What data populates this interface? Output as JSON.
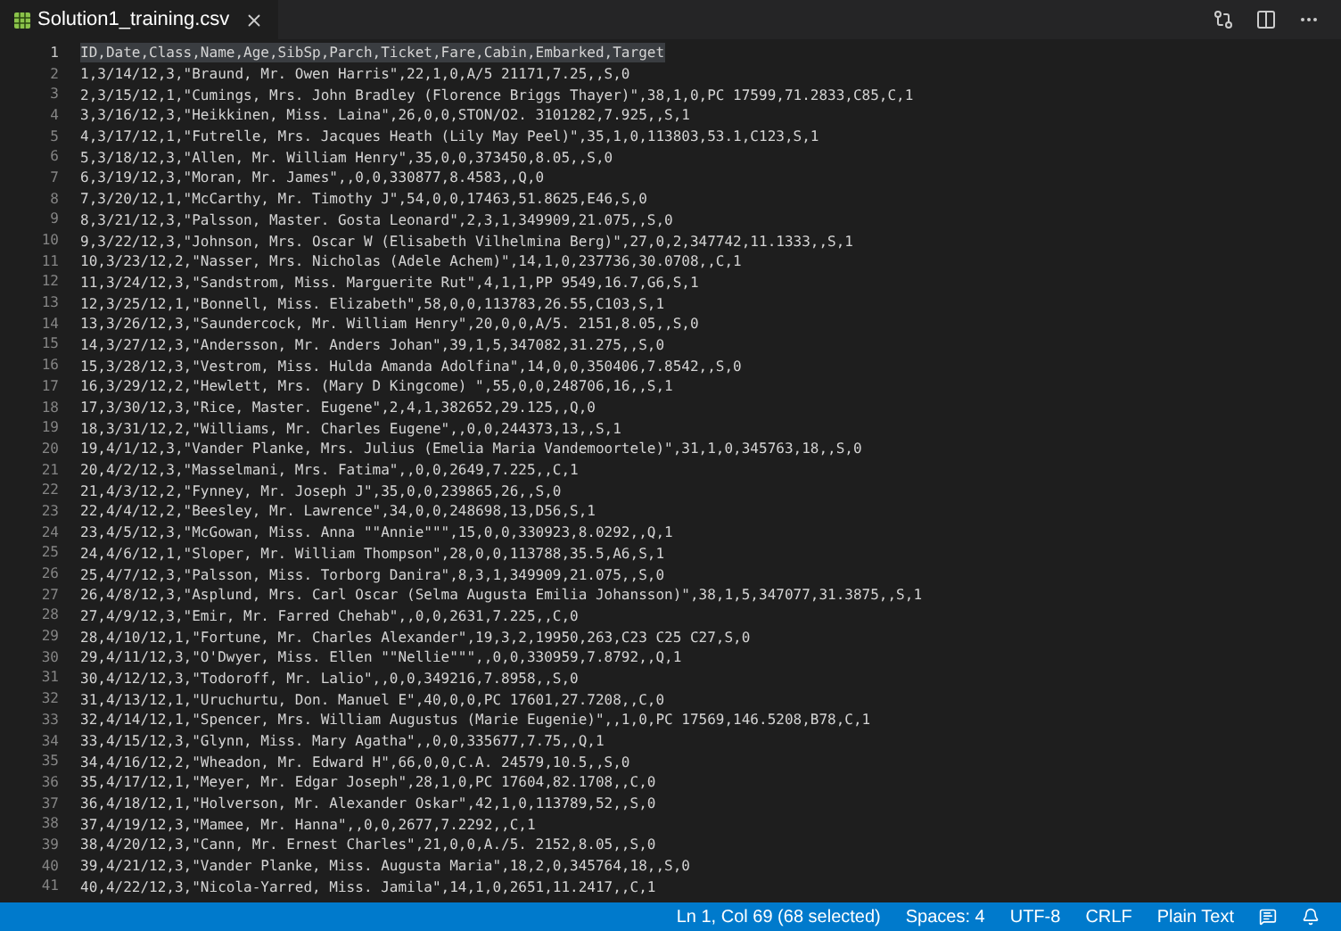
{
  "tab": {
    "title": "Solution1_training.csv",
    "selected": true
  },
  "editor": {
    "lines": [
      {
        "number": "1",
        "text": "ID,Date,Class,Name,Age,SibSp,Parch,Ticket,Fare,Cabin,Embarked,Target",
        "selected": true
      },
      {
        "number": "2",
        "text": "1,3/14/12,3,\"Braund, Mr. Owen Harris\",22,1,0,A/5 21171,7.25,,S,0",
        "selected": false
      },
      {
        "number": "3",
        "text": "2,3/15/12,1,\"Cumings, Mrs. John Bradley (Florence Briggs Thayer)\",38,1,0,PC 17599,71.2833,C85,C,1",
        "selected": false
      },
      {
        "number": "4",
        "text": "3,3/16/12,3,\"Heikkinen, Miss. Laina\",26,0,0,STON/O2. 3101282,7.925,,S,1",
        "selected": false
      },
      {
        "number": "5",
        "text": "4,3/17/12,1,\"Futrelle, Mrs. Jacques Heath (Lily May Peel)\",35,1,0,113803,53.1,C123,S,1",
        "selected": false
      },
      {
        "number": "6",
        "text": "5,3/18/12,3,\"Allen, Mr. William Henry\",35,0,0,373450,8.05,,S,0",
        "selected": false
      },
      {
        "number": "7",
        "text": "6,3/19/12,3,\"Moran, Mr. James\",,0,0,330877,8.4583,,Q,0",
        "selected": false
      },
      {
        "number": "8",
        "text": "7,3/20/12,1,\"McCarthy, Mr. Timothy J\",54,0,0,17463,51.8625,E46,S,0",
        "selected": false
      },
      {
        "number": "9",
        "text": "8,3/21/12,3,\"Palsson, Master. Gosta Leonard\",2,3,1,349909,21.075,,S,0",
        "selected": false
      },
      {
        "number": "10",
        "text": "9,3/22/12,3,\"Johnson, Mrs. Oscar W (Elisabeth Vilhelmina Berg)\",27,0,2,347742,11.1333,,S,1",
        "selected": false
      },
      {
        "number": "11",
        "text": "10,3/23/12,2,\"Nasser, Mrs. Nicholas (Adele Achem)\",14,1,0,237736,30.0708,,C,1",
        "selected": false
      },
      {
        "number": "12",
        "text": "11,3/24/12,3,\"Sandstrom, Miss. Marguerite Rut\",4,1,1,PP 9549,16.7,G6,S,1",
        "selected": false
      },
      {
        "number": "13",
        "text": "12,3/25/12,1,\"Bonnell, Miss. Elizabeth\",58,0,0,113783,26.55,C103,S,1",
        "selected": false
      },
      {
        "number": "14",
        "text": "13,3/26/12,3,\"Saundercock, Mr. William Henry\",20,0,0,A/5. 2151,8.05,,S,0",
        "selected": false
      },
      {
        "number": "15",
        "text": "14,3/27/12,3,\"Andersson, Mr. Anders Johan\",39,1,5,347082,31.275,,S,0",
        "selected": false
      },
      {
        "number": "16",
        "text": "15,3/28/12,3,\"Vestrom, Miss. Hulda Amanda Adolfina\",14,0,0,350406,7.8542,,S,0",
        "selected": false
      },
      {
        "number": "17",
        "text": "16,3/29/12,2,\"Hewlett, Mrs. (Mary D Kingcome) \",55,0,0,248706,16,,S,1",
        "selected": false
      },
      {
        "number": "18",
        "text": "17,3/30/12,3,\"Rice, Master. Eugene\",2,4,1,382652,29.125,,Q,0",
        "selected": false
      },
      {
        "number": "19",
        "text": "18,3/31/12,2,\"Williams, Mr. Charles Eugene\",,0,0,244373,13,,S,1",
        "selected": false
      },
      {
        "number": "20",
        "text": "19,4/1/12,3,\"Vander Planke, Mrs. Julius (Emelia Maria Vandemoortele)\",31,1,0,345763,18,,S,0",
        "selected": false
      },
      {
        "number": "21",
        "text": "20,4/2/12,3,\"Masselmani, Mrs. Fatima\",,0,0,2649,7.225,,C,1",
        "selected": false
      },
      {
        "number": "22",
        "text": "21,4/3/12,2,\"Fynney, Mr. Joseph J\",35,0,0,239865,26,,S,0",
        "selected": false
      },
      {
        "number": "23",
        "text": "22,4/4/12,2,\"Beesley, Mr. Lawrence\",34,0,0,248698,13,D56,S,1",
        "selected": false
      },
      {
        "number": "24",
        "text": "23,4/5/12,3,\"McGowan, Miss. Anna \"\"Annie\"\"\",15,0,0,330923,8.0292,,Q,1",
        "selected": false
      },
      {
        "number": "25",
        "text": "24,4/6/12,1,\"Sloper, Mr. William Thompson\",28,0,0,113788,35.5,A6,S,1",
        "selected": false
      },
      {
        "number": "26",
        "text": "25,4/7/12,3,\"Palsson, Miss. Torborg Danira\",8,3,1,349909,21.075,,S,0",
        "selected": false
      },
      {
        "number": "27",
        "text": "26,4/8/12,3,\"Asplund, Mrs. Carl Oscar (Selma Augusta Emilia Johansson)\",38,1,5,347077,31.3875,,S,1",
        "selected": false
      },
      {
        "number": "28",
        "text": "27,4/9/12,3,\"Emir, Mr. Farred Chehab\",,0,0,2631,7.225,,C,0",
        "selected": false
      },
      {
        "number": "29",
        "text": "28,4/10/12,1,\"Fortune, Mr. Charles Alexander\",19,3,2,19950,263,C23 C25 C27,S,0",
        "selected": false
      },
      {
        "number": "30",
        "text": "29,4/11/12,3,\"O'Dwyer, Miss. Ellen \"\"Nellie\"\"\",,0,0,330959,7.8792,,Q,1",
        "selected": false
      },
      {
        "number": "31",
        "text": "30,4/12/12,3,\"Todoroff, Mr. Lalio\",,0,0,349216,7.8958,,S,0",
        "selected": false
      },
      {
        "number": "32",
        "text": "31,4/13/12,1,\"Uruchurtu, Don. Manuel E\",40,0,0,PC 17601,27.7208,,C,0",
        "selected": false
      },
      {
        "number": "33",
        "text": "32,4/14/12,1,\"Spencer, Mrs. William Augustus (Marie Eugenie)\",,1,0,PC 17569,146.5208,B78,C,1",
        "selected": false
      },
      {
        "number": "34",
        "text": "33,4/15/12,3,\"Glynn, Miss. Mary Agatha\",,0,0,335677,7.75,,Q,1",
        "selected": false
      },
      {
        "number": "35",
        "text": "34,4/16/12,2,\"Wheadon, Mr. Edward H\",66,0,0,C.A. 24579,10.5,,S,0",
        "selected": false
      },
      {
        "number": "36",
        "text": "35,4/17/12,1,\"Meyer, Mr. Edgar Joseph\",28,1,0,PC 17604,82.1708,,C,0",
        "selected": false
      },
      {
        "number": "37",
        "text": "36,4/18/12,1,\"Holverson, Mr. Alexander Oskar\",42,1,0,113789,52,,S,0",
        "selected": false
      },
      {
        "number": "38",
        "text": "37,4/19/12,3,\"Mamee, Mr. Hanna\",,0,0,2677,7.2292,,C,1",
        "selected": false
      },
      {
        "number": "39",
        "text": "38,4/20/12,3,\"Cann, Mr. Ernest Charles\",21,0,0,A./5. 2152,8.05,,S,0",
        "selected": false
      },
      {
        "number": "40",
        "text": "39,4/21/12,3,\"Vander Planke, Miss. Augusta Maria\",18,2,0,345764,18,,S,0",
        "selected": false
      },
      {
        "number": "41",
        "text": "40,4/22/12,3,\"Nicola-Yarred, Miss. Jamila\",14,1,0,2651,11.2417,,C,1",
        "selected": false
      }
    ]
  },
  "status_bar": {
    "items": [
      "Ln 1, Col 69 (68 selected)",
      "Spaces: 4",
      "UTF-8",
      "CRLF",
      "Plain Text"
    ]
  }
}
